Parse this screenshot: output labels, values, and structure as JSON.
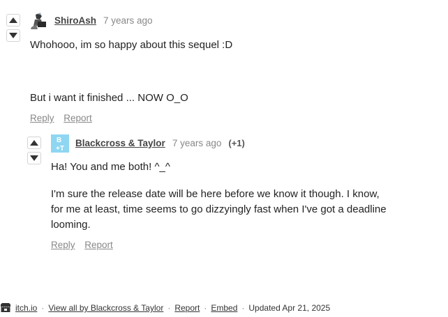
{
  "comments": [
    {
      "author": "ShiroAsh",
      "time": "7 years ago",
      "paragraphs": [
        "Whohooo, im so happy about this sequel :D",
        "But i want it finished ... NOW O_O"
      ],
      "actions": [
        "Reply",
        "Report"
      ]
    },
    {
      "author": "Blackcross & Taylor",
      "time": "7 years ago",
      "score": "(+1)",
      "paragraphs": [
        "Ha! You and me both! ^_^",
        "I'm sure the release date will be here before we know it though. I know, for me at least, time seems to go dizzyingly fast when I've got a deadline looming."
      ],
      "actions": [
        "Reply",
        "Report"
      ],
      "avatar_text": "B\n+T",
      "avatar_color": "#8ed6f2"
    }
  ],
  "footer": {
    "site": "itch.io",
    "view_all": "View all by Blackcross & Taylor",
    "report": "Report",
    "embed": "Embed",
    "updated": "Updated Apr 21, 2025",
    "separator": "·"
  },
  "colors": {
    "link": "#444444",
    "muted": "#888888",
    "border": "#d4d4d4"
  }
}
